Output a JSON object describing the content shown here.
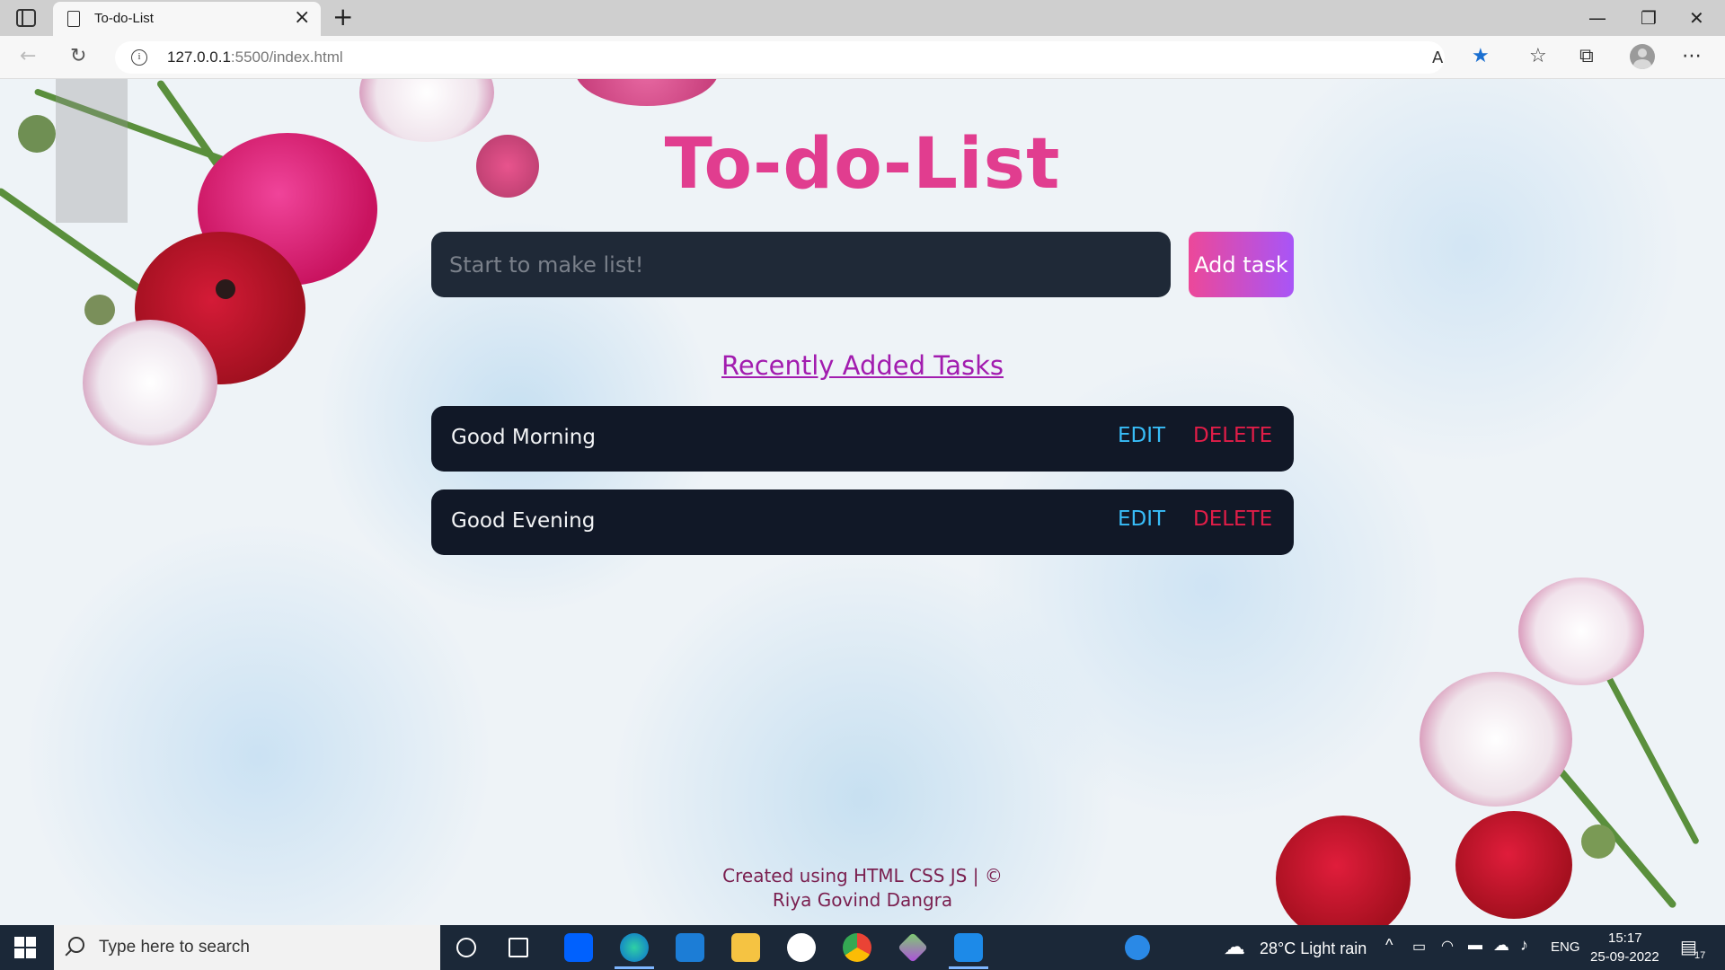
{
  "browser": {
    "tab_title": "To-do-List",
    "url_host": "127.0.0.1",
    "url_rest": ":5500/index.html"
  },
  "page": {
    "title": "To-do-List",
    "input_placeholder": "Start to make list!",
    "add_button": "Add task",
    "section_title": "Recently Added Tasks",
    "tasks": [
      {
        "text": "Good Morning",
        "edit": "EDIT",
        "delete": "DELETE"
      },
      {
        "text": "Good Evening",
        "edit": "EDIT",
        "delete": "DELETE"
      }
    ],
    "footer_line1": "Created using HTML CSS JS | ©",
    "footer_line2": "Riya Govind Dangra"
  },
  "taskbar": {
    "search_placeholder": "Type here to search",
    "weather": "28°C  Light rain",
    "language": "ENG",
    "time": "15:17",
    "date": "25-09-2022",
    "notifications": "17"
  },
  "colors": {
    "title": "#e13d8f",
    "edit": "#38bdf8",
    "delete": "#e11d48",
    "section_title": "#a21caf",
    "task_bg": "#111827"
  }
}
